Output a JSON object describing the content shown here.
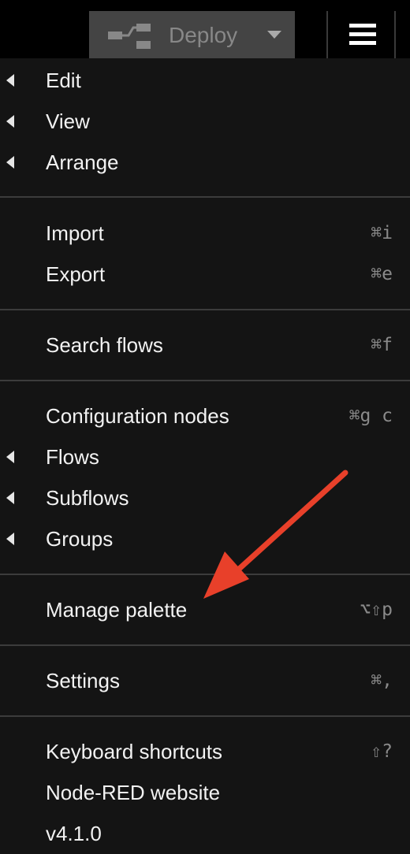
{
  "header": {
    "deploy_label": "Deploy"
  },
  "menu": {
    "items": [
      {
        "label": "Edit",
        "submenu": true,
        "shortcut": ""
      },
      {
        "label": "View",
        "submenu": true,
        "shortcut": ""
      },
      {
        "label": "Arrange",
        "submenu": true,
        "shortcut": ""
      },
      {
        "label": "Import",
        "submenu": false,
        "shortcut": "⌘i"
      },
      {
        "label": "Export",
        "submenu": false,
        "shortcut": "⌘e"
      },
      {
        "label": "Search flows",
        "submenu": false,
        "shortcut": "⌘f"
      },
      {
        "label": "Configuration nodes",
        "submenu": false,
        "shortcut": "⌘g c"
      },
      {
        "label": "Flows",
        "submenu": true,
        "shortcut": ""
      },
      {
        "label": "Subflows",
        "submenu": true,
        "shortcut": ""
      },
      {
        "label": "Groups",
        "submenu": true,
        "shortcut": ""
      },
      {
        "label": "Manage palette",
        "submenu": false,
        "shortcut": "⌥⇧p"
      },
      {
        "label": "Settings",
        "submenu": false,
        "shortcut": "⌘,"
      },
      {
        "label": "Keyboard shortcuts",
        "submenu": false,
        "shortcut": "⇧?"
      },
      {
        "label": "Node-RED website",
        "submenu": false,
        "shortcut": ""
      },
      {
        "label": "v4.1.0",
        "submenu": false,
        "shortcut": ""
      }
    ]
  },
  "colors": {
    "menu_background": "#141414",
    "header_background": "#000000",
    "deploy_button": "#444444",
    "annotation_arrow": "#e8402a"
  },
  "icons": {
    "deploy": "deploy-flow-icon",
    "deploy_dropdown": "chevron-down-icon",
    "main_menu": "hamburger-menu-icon",
    "submenu": "caret-left-icon",
    "annotation": "red-arrow-pointer"
  }
}
